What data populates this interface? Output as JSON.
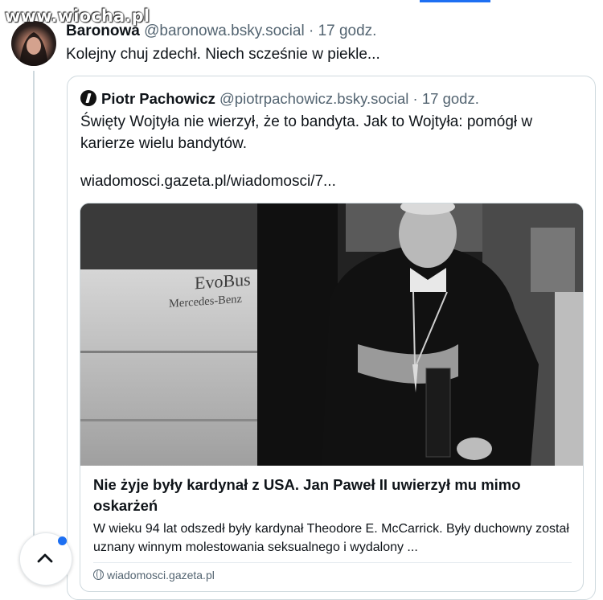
{
  "watermark": "www.wiocha.pl",
  "post": {
    "author": "Baronowa",
    "handle": "@baronowa.bsky.social",
    "separator": "·",
    "time": "17 godz.",
    "text": "Kolejny chuj zdechł. Niech scześnie w piekle..."
  },
  "quote": {
    "author": "Piotr Pachowicz",
    "handle": "@piotrpachowicz.bsky.social",
    "separator": "·",
    "time": "17 godz.",
    "text": "Święty Wojtyła nie wierzył, że to bandyta. Jak to Wojtyła: pomógł w karierze wielu bandytów.",
    "link": "wiadomosci.gazeta.pl/wiadomosci/7...",
    "card": {
      "image_bus_brand": "EvoBus",
      "image_bus_maker": "Mercedes-Benz",
      "title": "Nie żyje były kardynał z USA. Jan Paweł II uwierzył mu mimo oskarżeń",
      "description": "W wieku 94 lat odszedł były kardynał Theodore E. McCarrick. Były duchowny został uznany winnym molestowania seksualnego i wydalony ...",
      "domain": "wiadomosci.gazeta.pl"
    }
  },
  "colors": {
    "accent": "#1d6ff2",
    "muted": "#536471",
    "border": "#cfd9de"
  }
}
